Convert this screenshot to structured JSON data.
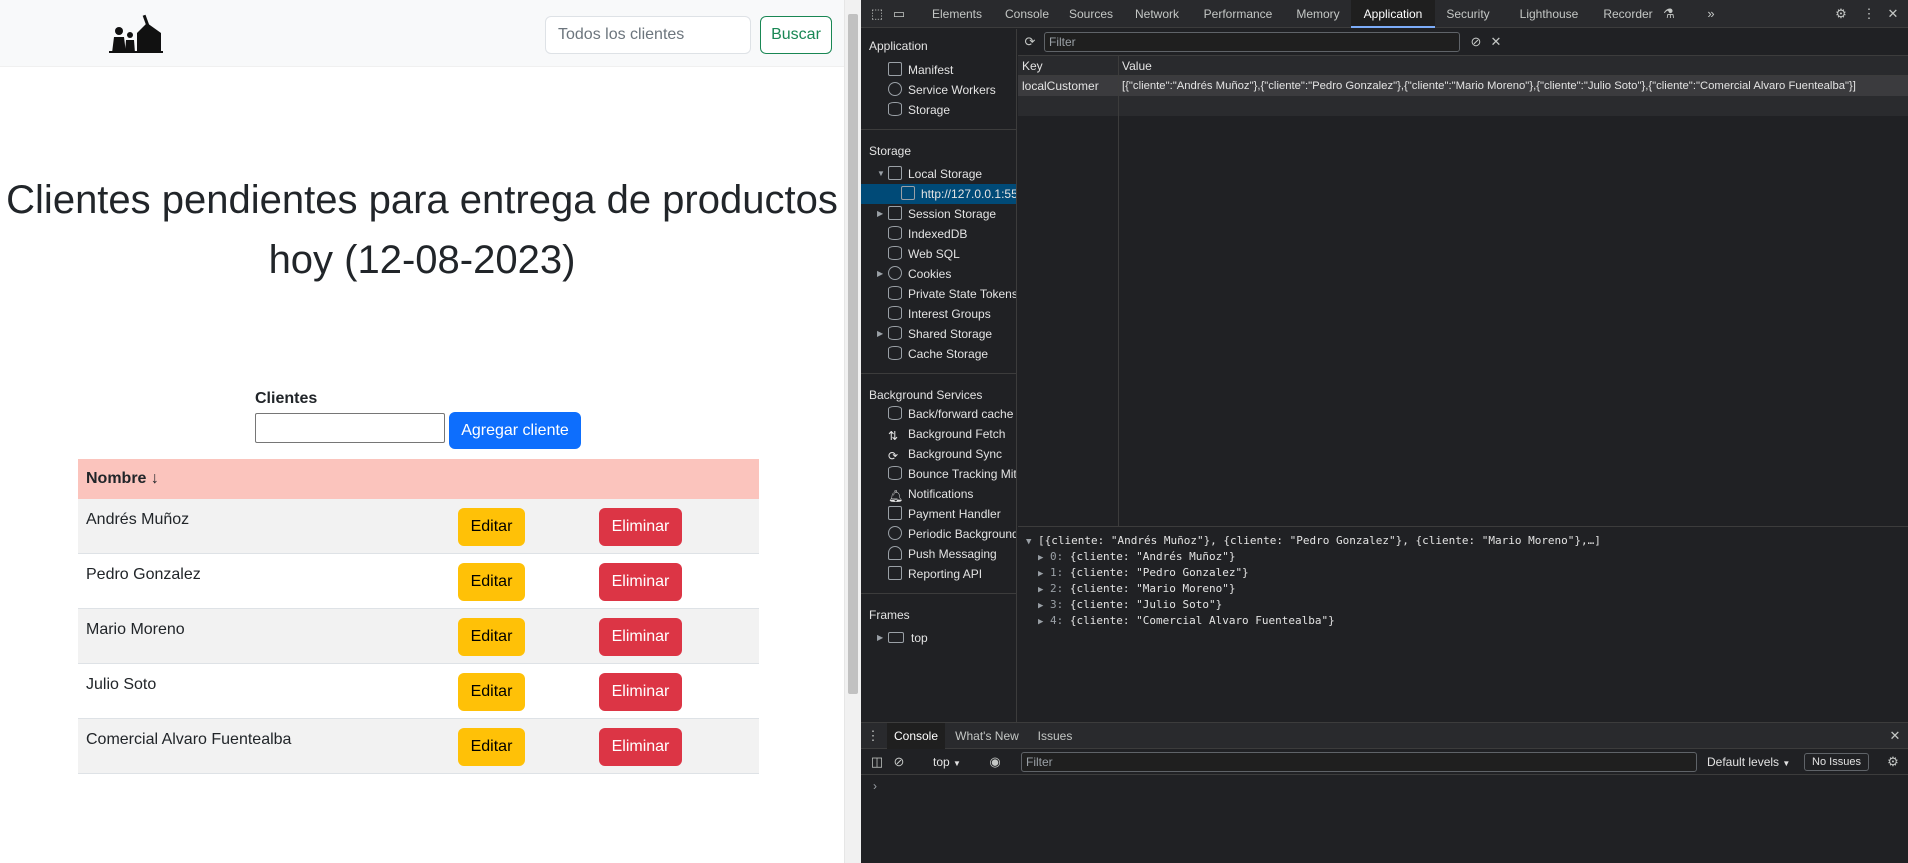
{
  "page": {
    "search": {
      "placeholder": "Todos los clientes",
      "button": "Buscar"
    },
    "headline_line1": "Clientes pendientes para entrega de productos",
    "headline_line2": "hoy (12-08-2023)",
    "form": {
      "label": "Clientes",
      "input_value": "",
      "add_button": "Agregar cliente"
    },
    "table": {
      "header": "Nombre ↓",
      "rows": [
        {
          "name": "Andrés Muñoz",
          "edit": "Editar",
          "delete": "Eliminar"
        },
        {
          "name": "Pedro Gonzalez",
          "edit": "Editar",
          "delete": "Eliminar"
        },
        {
          "name": "Mario Moreno",
          "edit": "Editar",
          "delete": "Eliminar"
        },
        {
          "name": "Julio Soto",
          "edit": "Editar",
          "delete": "Eliminar"
        },
        {
          "name": "Comercial Alvaro Fuentealba",
          "edit": "Editar",
          "delete": "Eliminar"
        }
      ]
    },
    "colors": {
      "header_row": "#fbc4bd",
      "primary": "#0d6efd",
      "warning": "#ffc107",
      "danger": "#dc3545",
      "success": "#198754"
    }
  },
  "devtools": {
    "tabs": [
      "Elements",
      "Console",
      "Sources",
      "Network",
      "Performance",
      "Memory",
      "Application",
      "Security",
      "Lighthouse",
      "Recorder"
    ],
    "active_tab": "Application",
    "sidebar": {
      "application_title": "Application",
      "application_items": [
        "Manifest",
        "Service Workers",
        "Storage"
      ],
      "storage_title": "Storage",
      "storage_items": [
        "Local Storage",
        "http://127.0.0.1:55",
        "Session Storage",
        "IndexedDB",
        "Web SQL",
        "Cookies",
        "Private State Tokens",
        "Interest Groups",
        "Shared Storage",
        "Cache Storage"
      ],
      "background_title": "Background Services",
      "background_items": [
        "Back/forward cache",
        "Background Fetch",
        "Background Sync",
        "Bounce Tracking Mit",
        "Notifications",
        "Payment Handler",
        "Periodic Background",
        "Push Messaging",
        "Reporting API"
      ],
      "frames_title": "Frames",
      "frames_items": [
        "top"
      ]
    },
    "storage": {
      "filter_placeholder": "Filter",
      "col_key": "Key",
      "col_value": "Value",
      "entry_key": "localCustomer",
      "entry_value": "[{\"cliente\":\"Andrés Muñoz\"},{\"cliente\":\"Pedro Gonzalez\"},{\"cliente\":\"Mario Moreno\"},{\"cliente\":\"Julio Soto\"},{\"cliente\":\"Comercial Alvaro Fuentealba\"}]"
    },
    "preview": {
      "summary": "[{cliente: \"Andrés Muñoz\"}, {cliente: \"Pedro Gonzalez\"}, {cliente: \"Mario Moreno\"},…]",
      "items": [
        {
          "idx": "0:",
          "text": "{cliente: \"Andrés Muñoz\"}"
        },
        {
          "idx": "1:",
          "text": "{cliente: \"Pedro Gonzalez\"}"
        },
        {
          "idx": "2:",
          "text": "{cliente: \"Mario Moreno\"}"
        },
        {
          "idx": "3:",
          "text": "{cliente: \"Julio Soto\"}"
        },
        {
          "idx": "4:",
          "text": "{cliente: \"Comercial Alvaro Fuentealba\"}"
        }
      ]
    },
    "drawer": {
      "tabs": [
        "Console",
        "What's New",
        "Issues"
      ],
      "context": "top",
      "filter_placeholder": "Filter",
      "levels": "Default levels",
      "issues": "No Issues",
      "prompt": "›"
    }
  }
}
